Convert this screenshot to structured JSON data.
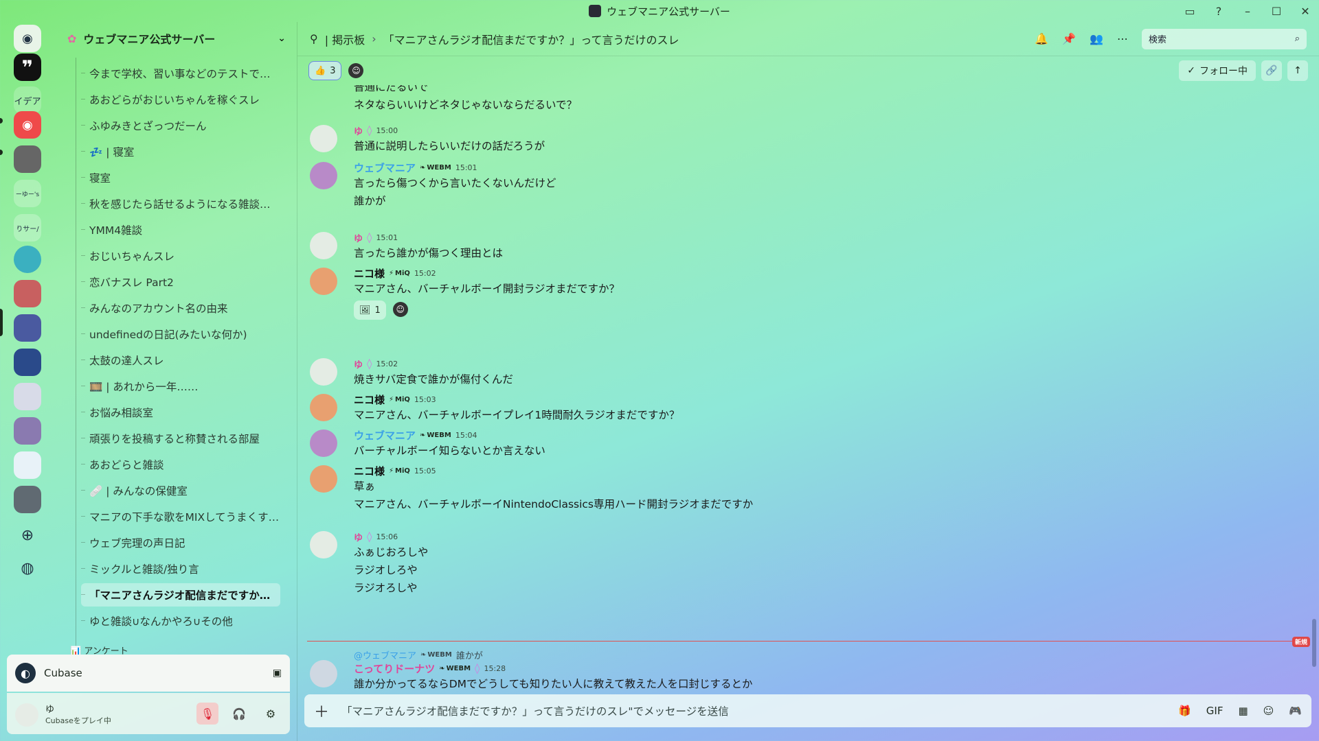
{
  "window": {
    "title": "ウェブマニア公式サーバー"
  },
  "rail": {
    "items": [
      {
        "name": "home",
        "label": ""
      },
      {
        "name": "quote",
        "label": ""
      },
      {
        "name": "idea",
        "label": "イデア"
      },
      {
        "name": "discord",
        "label": ""
      },
      {
        "name": "server-a",
        "label": ""
      },
      {
        "name": "server-b",
        "label": "ーゆー's"
      },
      {
        "name": "server-c",
        "label": "りサー/"
      }
    ]
  },
  "sidebar": {
    "server_name": "ウェブマニア公式サーバー",
    "channels": [
      "今まで学校、習い事などのテストで…",
      "あおどらがおじいちゃんを稼ぐスレ",
      "ふゆみきとざっつだーん",
      "💤 | 寝室",
      "寝室",
      "秋を感じたら話せるようになる雑談…",
      "YMM4雑談",
      "おじいちゃんスレ",
      "恋バナスレ Part2",
      "みんなのアカウント名の由来",
      "undefinedの日記(みたいな何か)",
      "太鼓の達人スレ",
      "🎞️ | あれから一年……",
      "お悩み相談室",
      "頑張りを投稿すると称賛される部屋",
      "あおどらと雑談",
      "🩹 | みんなの保健室",
      "マニアの下手な歌をMIXしてうまくす…",
      "ウェブ完理の声日記",
      "ミックルと雑談/独り言",
      "「マニアさんラジオ配信まだですか…",
      "ゆと雑談∪なんかやろ∪その他"
    ],
    "partial_category": "📊 アンケート"
  },
  "activity": {
    "app": "Cubase"
  },
  "user": {
    "name": "ゆ",
    "status": "Cubaseをプレイ中"
  },
  "topbar": {
    "forum": "| 掲示板",
    "thread": "「マニアさんラジオ配信まだですか？」って言うだけのスレ",
    "search_placeholder": "検索"
  },
  "subbar": {
    "reaction_count": "3",
    "follow_label": "フォロー中"
  },
  "messages": {
    "partial_top": [
      "普通にだるいで",
      "ネタならいいけどネタじゃないならだるいで？"
    ],
    "list": [
      {
        "user": "ゆ",
        "kind": "yu",
        "tag": "",
        "time": "15:00",
        "lines": [
          "普通に説明したらいいだけの話だろうが"
        ]
      },
      {
        "user": "ウェブマニア",
        "kind": "web",
        "tag": "WEBM",
        "time": "15:01",
        "lines": [
          "言ったら傷つくから言いたくないんだけど",
          "誰かが"
        ]
      },
      {
        "user": "ゆ",
        "kind": "yu",
        "tag": "",
        "time": "15:01",
        "lines": [
          "言ったら誰かが傷つく理由とは"
        ]
      },
      {
        "user": "ニコ様",
        "kind": "niko",
        "tag": "MiQ",
        "time": "15:02",
        "lines": [
          "マニアさん、バーチャルボーイ開封ラジオまだですか？"
        ],
        "reaction": "1"
      },
      {
        "user": "ゆ",
        "kind": "yu",
        "tag": "",
        "time": "15:02",
        "lines": [
          "焼きサバ定食で誰かが傷付くんだ"
        ]
      },
      {
        "user": "ニコ様",
        "kind": "niko",
        "tag": "MiQ",
        "time": "15:03",
        "lines": [
          "マニアさん、バーチャルボーイプレイ1時間耐久ラジオまだですか？"
        ]
      },
      {
        "user": "ウェブマニア",
        "kind": "web",
        "tag": "WEBM",
        "time": "15:04",
        "lines": [
          "バーチャルボーイ知らないとか言えない"
        ]
      },
      {
        "user": "ニコ様",
        "kind": "niko",
        "tag": "MiQ",
        "time": "15:05",
        "lines": [
          "草ぁ",
          "マニアさん、バーチャルボーイNintendoClassics専用ハード開封ラジオまだですか"
        ]
      },
      {
        "user": "ゆ",
        "kind": "yu",
        "tag": "",
        "time": "15:06",
        "lines": [
          "ふぁじおろしや",
          "ラジオしろや",
          "ラジオろしや"
        ]
      }
    ],
    "new_badge": "新規",
    "reply": {
      "ref_user": "@ウェブマニア",
      "ref_tag": "WEBM",
      "ref_text": "誰かが",
      "user": "こってりドーナツ",
      "tag": "WEBM",
      "time": "15:28",
      "text": "誰か分かってるならDMでどうしても知りたい人に教えて教えた人を口封じするとか"
    }
  },
  "composer": {
    "placeholder": "「マニアさんラジオ配信まだですか？」って言うだけのスレ\"でメッセージを送信"
  },
  "colors": {
    "accent_pink": "#e0469a",
    "accent_blue": "#3aa0e8",
    "new_red": "#e04848"
  }
}
